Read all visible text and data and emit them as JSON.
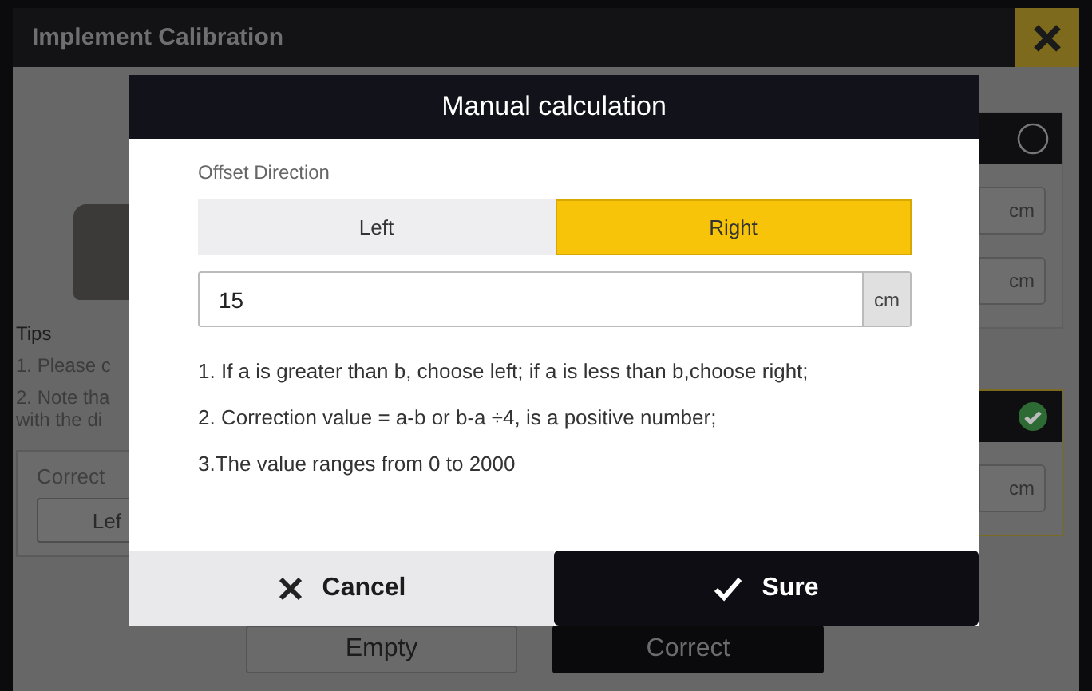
{
  "window": {
    "title": "Implement Calibration"
  },
  "background": {
    "tips_title": "Tips",
    "tips": [
      "1. Please c",
      "2. Note tha",
      "with the di"
    ],
    "correct_panel": {
      "label": "Correct",
      "button": "Lef"
    },
    "right_panels": [
      {
        "checked": false,
        "units": [
          "cm",
          "cm"
        ]
      },
      {
        "checked": true,
        "units": [
          "cm"
        ]
      }
    ],
    "buttons": [
      {
        "label": "Empty",
        "kind": "secondary"
      },
      {
        "label": "Correct",
        "kind": "primary"
      }
    ]
  },
  "dialog": {
    "title": "Manual calculation",
    "field_label": "Offset Direction",
    "directions": [
      {
        "label": "Left",
        "selected": false
      },
      {
        "label": "Right",
        "selected": true
      }
    ],
    "offset": {
      "value": "15",
      "unit": "cm"
    },
    "notes": [
      "1. If a is greater than b, choose left; if a is less than b,choose right;",
      "2. Correction value = a-b or b-a ÷4, is a positive number;",
      "3.The value ranges from 0 to 2000"
    ],
    "buttons": [
      {
        "label": "Cancel",
        "kind": "cancel"
      },
      {
        "label": "Sure",
        "kind": "confirm"
      }
    ]
  }
}
